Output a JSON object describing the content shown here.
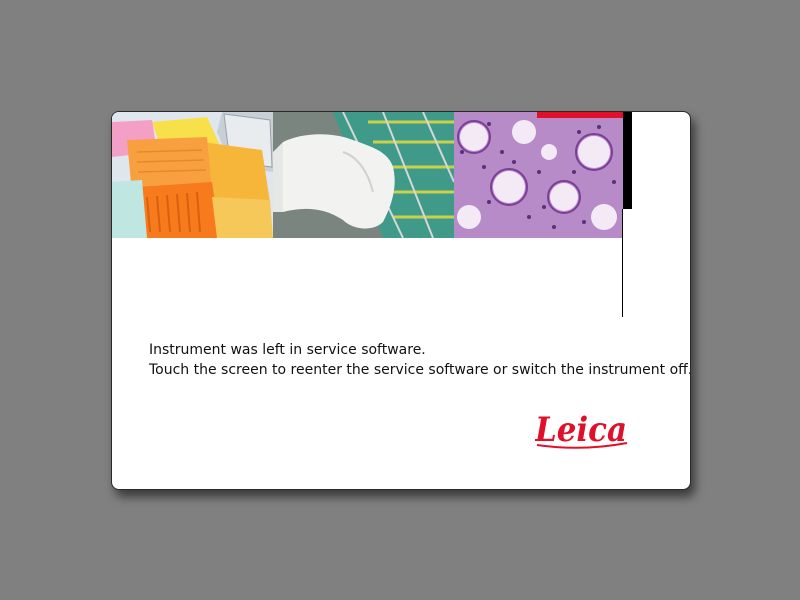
{
  "dialog": {
    "message_line1": "Instrument was left in service software.",
    "message_line2": "Touch the screen to reenter the service software or switch the instrument off.",
    "brand": "Leica"
  },
  "colors": {
    "background": "#808080",
    "brand_red": "#e0102a",
    "card": "#ffffff"
  },
  "banner": {
    "images": [
      "tissue-cassettes-photo",
      "gloved-hand-rack-photo",
      "histology-tissue-photo"
    ]
  }
}
